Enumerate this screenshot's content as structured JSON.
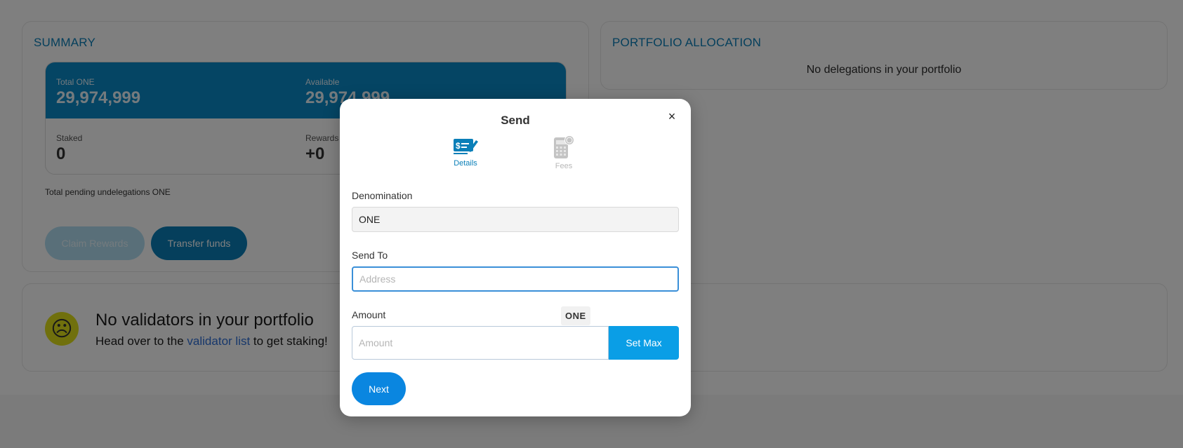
{
  "summary": {
    "title": "SUMMARY",
    "total_label": "Total ONE",
    "total_value": "29,974,999",
    "available_label": "Available",
    "available_value": "29,974,999",
    "staked_label": "Staked",
    "staked_value": "0",
    "rewards_label": "Rewards",
    "rewards_value": "+0",
    "pending_text": "Total pending undelegations ONE",
    "claim_label": "Claim Rewards",
    "transfer_label": "Transfer funds"
  },
  "portfolio": {
    "title": "PORTFOLIO ALLOCATION",
    "empty_text": "No delegations in your portfolio"
  },
  "validators": {
    "title": "No validators in your portfolio",
    "sub_prefix": "Head over to the ",
    "link_text": "validator list",
    "sub_suffix": " to get staking!"
  },
  "modal": {
    "title": "Send",
    "close": "×",
    "steps": [
      {
        "label": "Details",
        "icon": "check-writing-icon",
        "active": true
      },
      {
        "label": "Fees",
        "icon": "calculator-icon",
        "active": false
      }
    ],
    "denomination_label": "Denomination",
    "denomination_value": "ONE",
    "send_to_label": "Send To",
    "send_to_placeholder": "Address",
    "amount_label": "Amount",
    "amount_unit": "ONE",
    "amount_placeholder": "Amount",
    "set_max_label": "Set Max",
    "next_label": "Next"
  },
  "colors": {
    "accent": "#0a7fb8",
    "primary_button": "#0a86e0",
    "set_max": "#0a9ee6",
    "balance_band": "#0a8ac9"
  }
}
